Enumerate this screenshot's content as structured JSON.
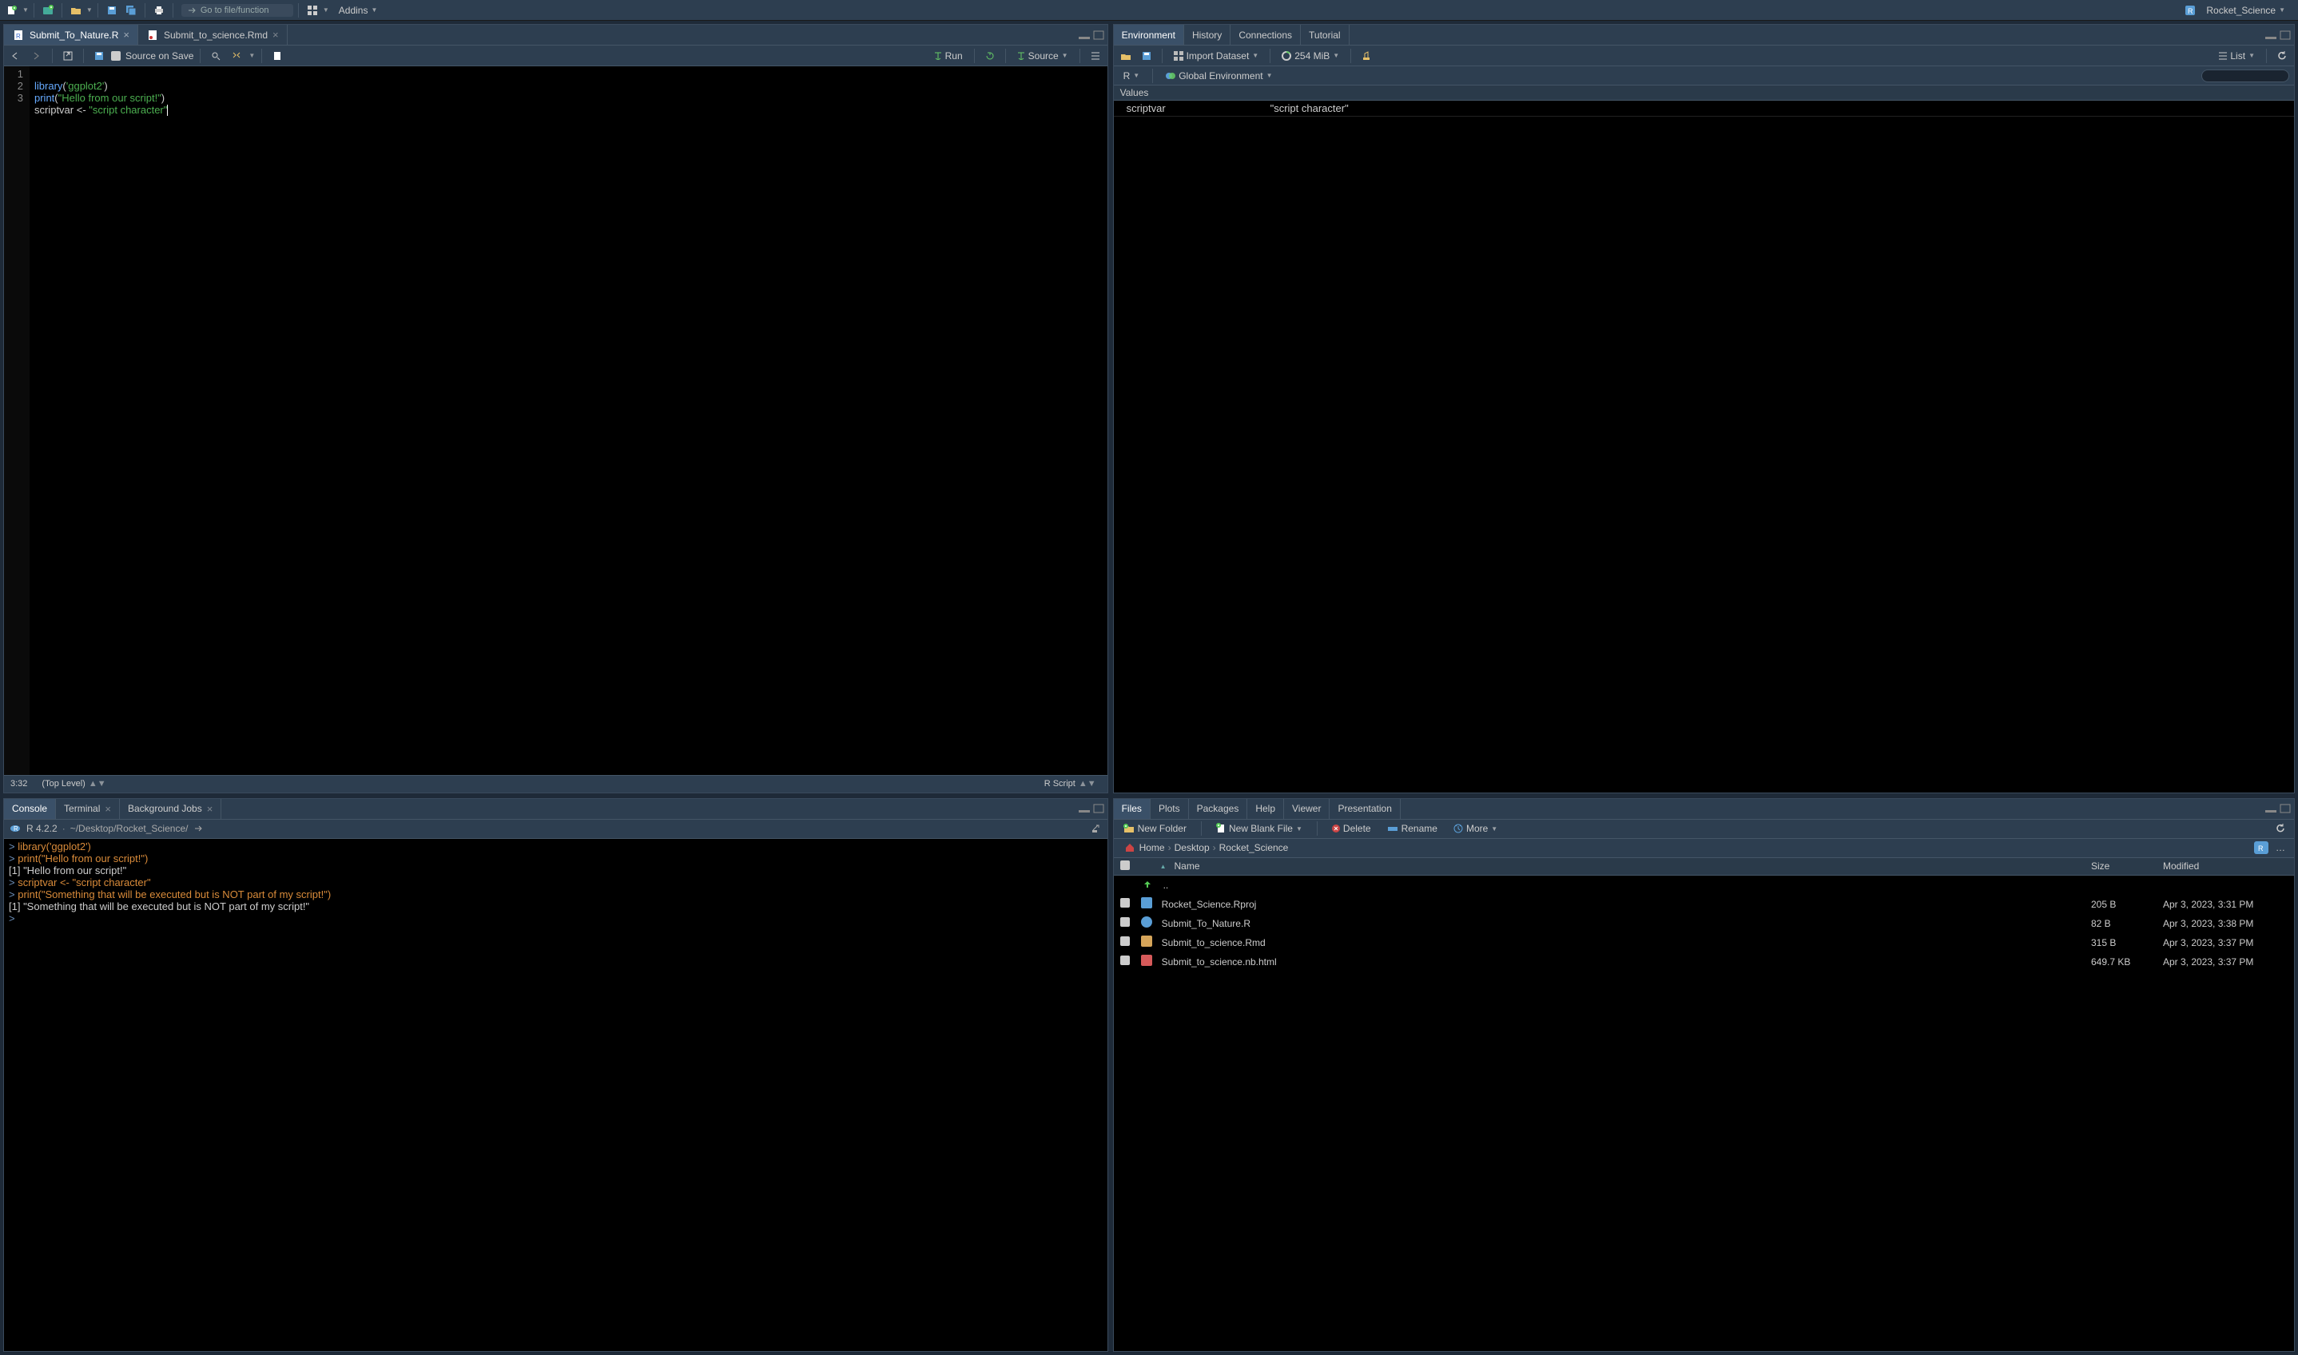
{
  "global": {
    "goto_placeholder": "Go to file/function",
    "addins_label": "Addins",
    "project_name": "Rocket_Science"
  },
  "source": {
    "tabs": [
      {
        "label": "Submit_To_Nature.R",
        "active": true
      },
      {
        "label": "Submit_to_science.Rmd",
        "active": false
      }
    ],
    "toolbar": {
      "source_on_save": "Source on Save",
      "run": "Run",
      "source": "Source"
    },
    "lines": [
      "1",
      "2",
      "3"
    ],
    "code": {
      "l1_fn": "library",
      "l1_p1": "(",
      "l1_s": "'ggplot2'",
      "l1_p2": ")",
      "l2_fn": "print",
      "l2_p1": "(",
      "l2_s": "\"Hello from our script!\"",
      "l2_p2": ")",
      "l3_v": "scriptvar ",
      "l3_op": "<- ",
      "l3_s": "\"script character\""
    },
    "status_pos": "3:32",
    "status_scope": "(Top Level)",
    "status_type": "R Script"
  },
  "console": {
    "tabs": [
      {
        "label": "Console",
        "active": true
      },
      {
        "label": "Terminal",
        "active": false
      },
      {
        "label": "Background Jobs",
        "active": false
      }
    ],
    "rver": "R 4.2.2",
    "path": "~/Desktop/Rocket_Science/",
    "lines": [
      {
        "t": "cmd",
        "prompt": "> ",
        "text": "library('ggplot2')"
      },
      {
        "t": "cmd",
        "prompt": "> ",
        "text": "print(\"Hello from our script!\")"
      },
      {
        "t": "out",
        "text": "[1] \"Hello from our script!\""
      },
      {
        "t": "cmd",
        "prompt": "> ",
        "text": "scriptvar <- \"script character\""
      },
      {
        "t": "cmd",
        "prompt": "> ",
        "text": "print(\"Something that will be executed but is NOT part of my script!\")"
      },
      {
        "t": "out",
        "text": "[1] \"Something that will be executed but is NOT part of my script!\""
      },
      {
        "t": "cmd",
        "prompt": "> ",
        "text": ""
      }
    ]
  },
  "env": {
    "tabs": [
      {
        "label": "Environment",
        "active": true
      },
      {
        "label": "History",
        "active": false
      },
      {
        "label": "Connections",
        "active": false
      },
      {
        "label": "Tutorial",
        "active": false
      }
    ],
    "toolbar": {
      "import": "Import Dataset",
      "mem": "254 MiB",
      "view": "List"
    },
    "lang": "R",
    "scope": "Global Environment",
    "section": "Values",
    "rows": [
      {
        "var": "scriptvar",
        "val": "\"script character\""
      }
    ]
  },
  "files": {
    "tabs": [
      {
        "label": "Files",
        "active": true
      },
      {
        "label": "Plots",
        "active": false
      },
      {
        "label": "Packages",
        "active": false
      },
      {
        "label": "Help",
        "active": false
      },
      {
        "label": "Viewer",
        "active": false
      },
      {
        "label": "Presentation",
        "active": false
      }
    ],
    "toolbar": {
      "new_folder": "New Folder",
      "new_file": "New Blank File",
      "delete": "Delete",
      "rename": "Rename",
      "more": "More"
    },
    "breadcrumb": [
      "Home",
      "Desktop",
      "Rocket_Science"
    ],
    "cols": {
      "name": "Name",
      "size": "Size",
      "modified": "Modified"
    },
    "up": "..",
    "rows": [
      {
        "name": "Rocket_Science.Rproj",
        "icon": "rproj",
        "size": "205 B",
        "modified": "Apr 3, 2023, 3:31 PM"
      },
      {
        "name": "Submit_To_Nature.R",
        "icon": "r",
        "size": "82 B",
        "modified": "Apr 3, 2023, 3:38 PM"
      },
      {
        "name": "Submit_to_science.Rmd",
        "icon": "rmd",
        "size": "315 B",
        "modified": "Apr 3, 2023, 3:37 PM"
      },
      {
        "name": "Submit_to_science.nb.html",
        "icon": "html",
        "size": "649.7 KB",
        "modified": "Apr 3, 2023, 3:37 PM"
      }
    ]
  }
}
